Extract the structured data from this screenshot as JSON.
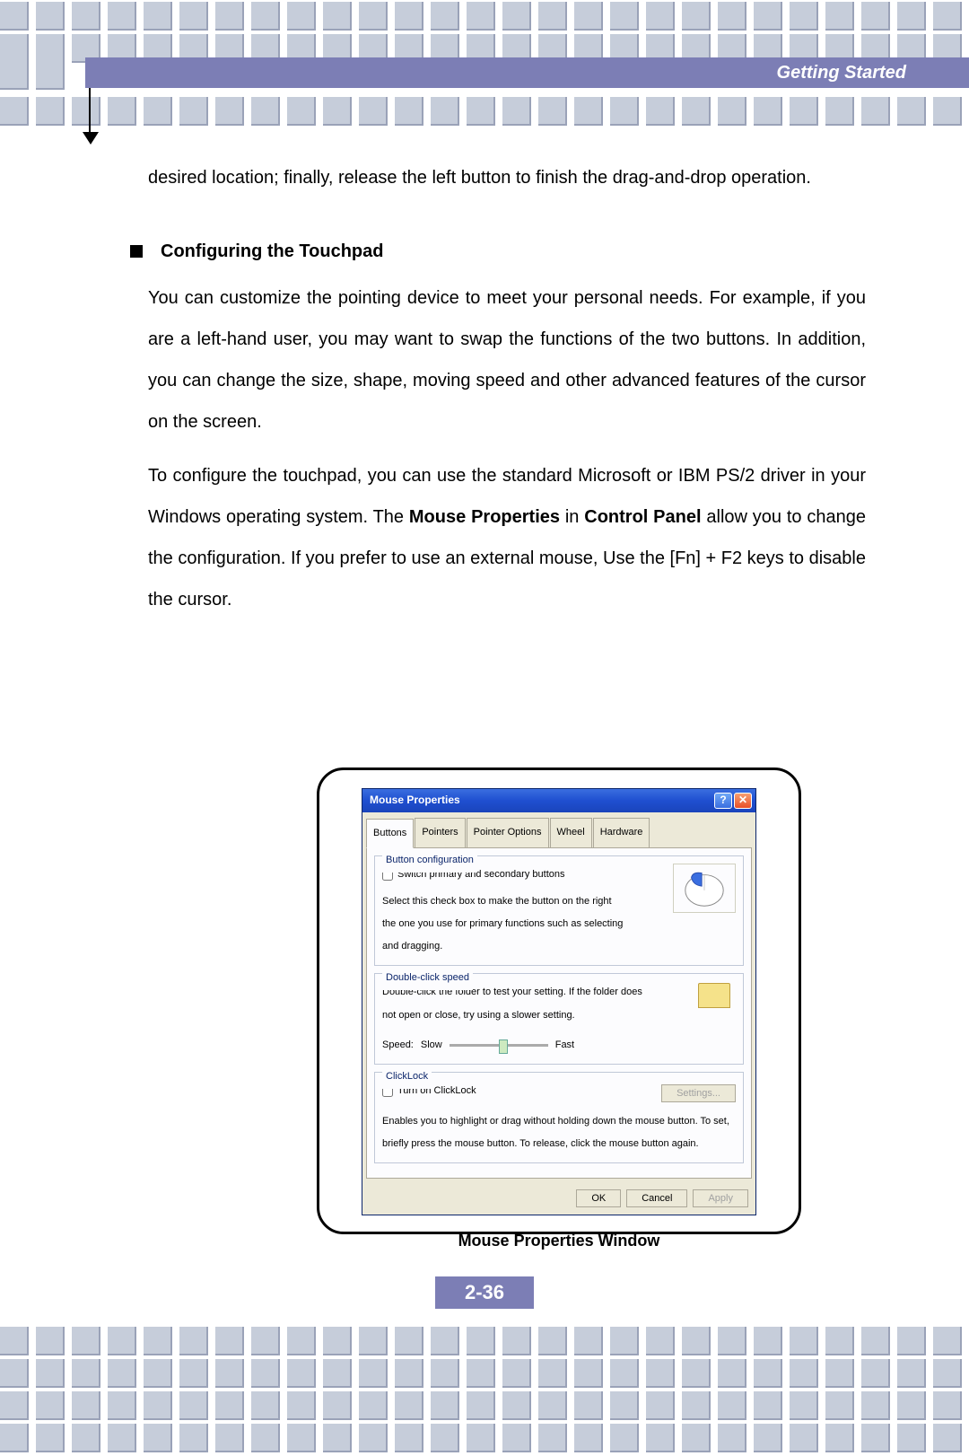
{
  "header": {
    "title": "Getting Started"
  },
  "body": {
    "p1": "desired location; finally, release the left button to finish the drag-and-drop operation.",
    "bullet_title": "Configuring the Touchpad",
    "p2": "You can customize the pointing device to meet your personal needs.  For example, if you are a left-hand user, you may want to swap the functions of the two buttons.  In addition, you can change the size, shape, moving speed and other advanced features of the cursor on the screen.",
    "p3a": "To configure the touchpad, you can use the standard Microsoft or IBM PS/2 driver in your Windows operating system.  The ",
    "p3b": "Mouse Properties",
    "p3c": " in ",
    "p3d": "Control Panel",
    "p3e": " allow you to change the configuration.   If you prefer to use an external mouse, Use the [Fn] + F2 keys to disable the cursor."
  },
  "dialog": {
    "title": "Mouse Properties",
    "tabs": [
      "Buttons",
      "Pointers",
      "Pointer Options",
      "Wheel",
      "Hardware"
    ],
    "group1": {
      "title": "Button configuration",
      "check": "Switch primary and secondary buttons",
      "desc": "Select this check box to make the button on the right the one you use for primary functions such as selecting and dragging."
    },
    "group2": {
      "title": "Double-click speed",
      "desc": "Double-click the folder to test your setting. If the folder does not open or close, try using a slower setting.",
      "speed_label": "Speed:",
      "slow": "Slow",
      "fast": "Fast"
    },
    "group3": {
      "title": "ClickLock",
      "check": "Turn on ClickLock",
      "settings_btn": "Settings...",
      "desc": "Enables you to highlight or drag without holding down the mouse button. To set, briefly press the mouse button. To release, click the mouse button again."
    },
    "ok": "OK",
    "cancel": "Cancel",
    "apply": "Apply"
  },
  "caption": "Mouse Properties Window",
  "page_num": "2-36"
}
